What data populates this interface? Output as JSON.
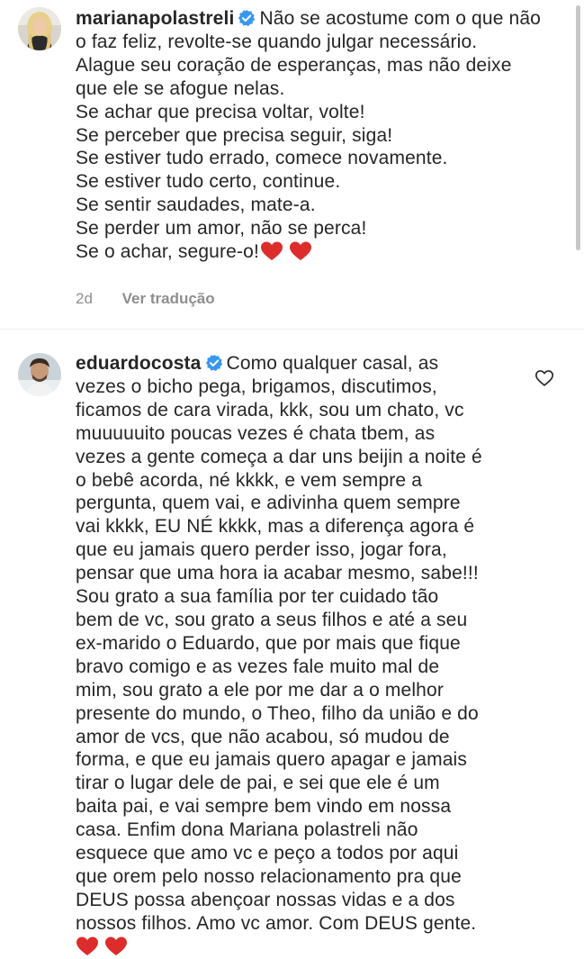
{
  "comments": [
    {
      "username": "marianapolastreli",
      "verified": true,
      "lines": [
        "Não se acostume com o que não",
        "o faz feliz, revolte-se quando julgar necessário.",
        "Alague seu coração de esperanças, mas não deixe",
        "que ele se afogue nelas.",
        "Se achar que precisa voltar, volte!",
        "Se perceber que precisa seguir, siga!",
        "Se estiver tudo errado, comece novamente.",
        "Se estiver tudo certo, continue.",
        "Se sentir saudades, mate-a.",
        "Se perder um amor, não se perca!",
        "Se o achar, segure-o!"
      ],
      "time": "2d",
      "translate_label": "Ver tradução"
    },
    {
      "username": "eduardocosta",
      "verified": true,
      "lines": [
        "Como qualquer casal, as",
        "vezes o bicho pega, brigamos, discutimos,",
        "ficamos de cara virada, kkk, sou um chato, vc",
        "muuuuuito poucas vezes é chata tbem, as",
        "vezes a gente começa a dar uns beijin a noite é",
        "o bebê acorda, né kkkk, e vem sempre a",
        "pergunta, quem vai, e adivinha quem sempre",
        "vai kkkk, EU NÉ kkkk, mas a diferença agora é",
        "que eu jamais quero perder isso, jogar fora,",
        "pensar que uma hora ia acabar mesmo, sabe!!!",
        "Sou grato a sua família por ter cuidado tão",
        "bem de vc, sou grato a seus filhos e até a seu",
        "ex-marido o Eduardo, que por mais que fique",
        "bravo comigo e as vezes fale muito mal de",
        "mim, sou grato a ele por me dar a o melhor",
        "presente do mundo, o Theo, filho da união e do",
        "amor de vcs, que não acabou, só mudou de",
        "forma, e que eu jamais quero apagar e jamais",
        "tirar o lugar dele de pai, e sei que ele é um",
        "baita pai, e vai sempre bem vindo em nossa",
        "casa. Enfim dona Mariana polastreli não",
        "esquece que amo vc e peço a todos por aqui",
        "que orem pelo nosso relacionamento pra que",
        "DEUS possa abençoar nossas vidas e a dos",
        "nossos filhos. Amo vc amor. Com DEUS gente."
      ]
    }
  ],
  "icons": {
    "verified": "verified-badge-icon",
    "heart_emoji": "red-heart-emoji",
    "like": "heart-outline-icon"
  },
  "colors": {
    "text": "#262626",
    "secondary": "#8e8e8e",
    "verified_blue": "#3897f0",
    "heart_red": "#dd2c2c"
  }
}
